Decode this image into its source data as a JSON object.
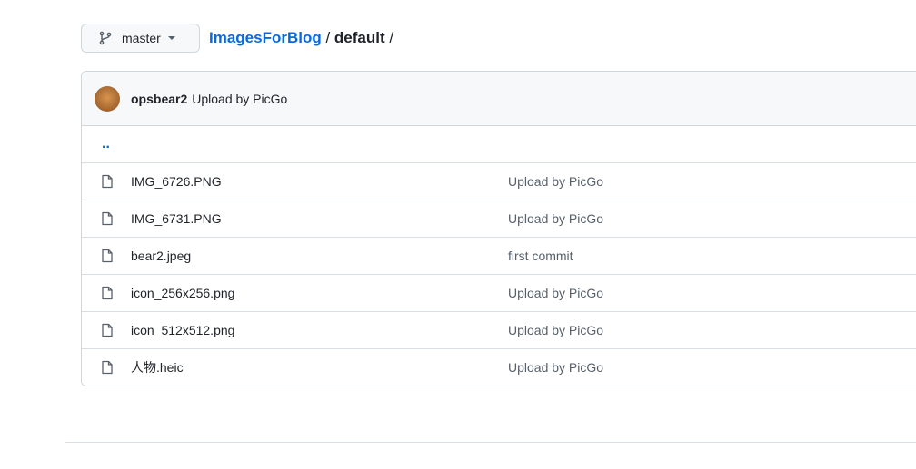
{
  "branch": {
    "name": "master",
    "icon": "git-branch-icon"
  },
  "breadcrumb": {
    "repo": "ImagesForBlog",
    "sep1": " / ",
    "folder": "default",
    "sep2": " /"
  },
  "commit": {
    "author": "opsbear2",
    "message": "Upload by PicGo"
  },
  "parent_link": "..",
  "files": [
    {
      "name": "IMG_6726.PNG",
      "message": "Upload by PicGo"
    },
    {
      "name": "IMG_6731.PNG",
      "message": "Upload by PicGo"
    },
    {
      "name": "bear2.jpeg",
      "message": "first commit"
    },
    {
      "name": "icon_256x256.png",
      "message": "Upload by PicGo"
    },
    {
      "name": "icon_512x512.png",
      "message": "Upload by PicGo"
    },
    {
      "name": "人物.heic",
      "message": "Upload by PicGo"
    }
  ]
}
